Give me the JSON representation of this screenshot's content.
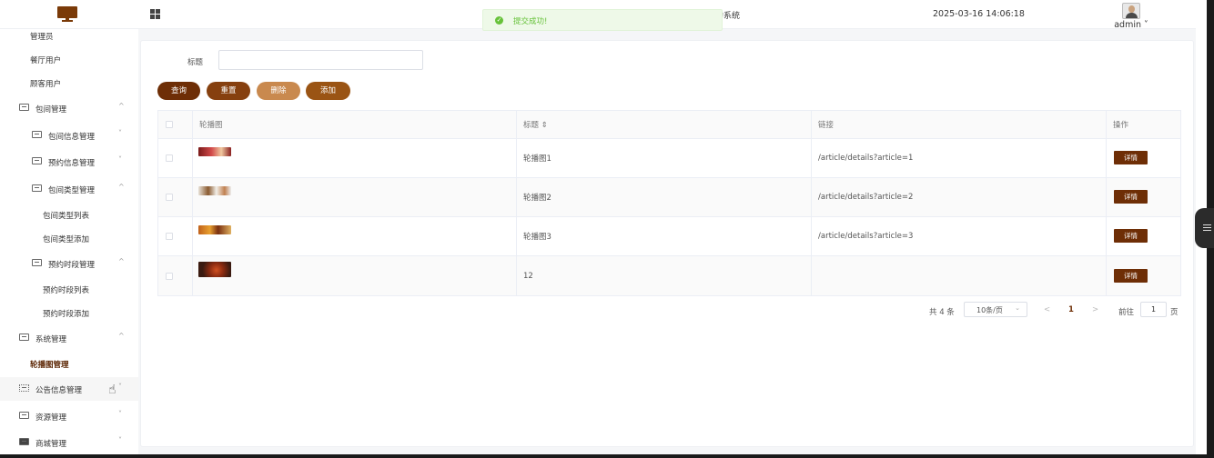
{
  "header": {
    "system_title": "约系统",
    "datetime": "2025-03-16 14:06:18",
    "user_name": "admin ˅",
    "logo_icon": "monitor-icon",
    "menu_toggle_icon": "grid-icon",
    "brand_color": "#7a3a08"
  },
  "toast": {
    "icon": "success-check-icon",
    "message": "提交成功!",
    "color": "#67c23a"
  },
  "sidebar": {
    "items": [
      {
        "label": "管理员",
        "type": "leaf"
      },
      {
        "label": "餐厅用户",
        "type": "leaf"
      },
      {
        "label": "顾客用户",
        "type": "leaf"
      },
      {
        "label": "包间管理",
        "type": "group",
        "caret": "^"
      },
      {
        "label": "包间信息管理",
        "type": "subgroup",
        "caret": "˅"
      },
      {
        "label": "预约信息管理",
        "type": "subgroup",
        "caret": "˅"
      },
      {
        "label": "包间类型管理",
        "type": "subgroup",
        "caret": "^"
      },
      {
        "label": "包间类型列表",
        "type": "subleaf"
      },
      {
        "label": "包间类型添加",
        "type": "subleaf"
      },
      {
        "label": "预约时段管理",
        "type": "subgroup",
        "caret": "^"
      },
      {
        "label": "预约时段列表",
        "type": "subleaf"
      },
      {
        "label": "预约时段添加",
        "type": "subleaf"
      },
      {
        "label": "系统管理",
        "type": "group",
        "caret": "^"
      },
      {
        "label": "轮播图管理",
        "type": "leaf-active"
      },
      {
        "label": "公告信息管理",
        "type": "group",
        "caret": "˅"
      },
      {
        "label": "资源管理",
        "type": "group",
        "caret": "˅"
      },
      {
        "label": "商城管理",
        "type": "group",
        "caret": "˅"
      }
    ]
  },
  "search": {
    "title_label": "标题",
    "title_value": ""
  },
  "actions": {
    "query": "查询",
    "reset": "重置",
    "delete": "删除",
    "add": "添加"
  },
  "table": {
    "columns": [
      "轮播图",
      "标题 ⇕",
      "链接",
      "操作"
    ],
    "rows": [
      {
        "title": "轮播图1",
        "link": "/article/details?article=1",
        "action": "详情"
      },
      {
        "title": "轮播图2",
        "link": "/article/details?article=2",
        "action": "详情"
      },
      {
        "title": "轮播图3",
        "link": "/article/details?article=3",
        "action": "详情"
      },
      {
        "title": "12",
        "link": "",
        "action": "详情"
      }
    ]
  },
  "pagination": {
    "total": "共 4 条",
    "page_size": "10条/页",
    "prev": "<",
    "current": "1",
    "next": ">",
    "goto_label": "前往",
    "goto_value": "1",
    "page_suffix": "页"
  }
}
